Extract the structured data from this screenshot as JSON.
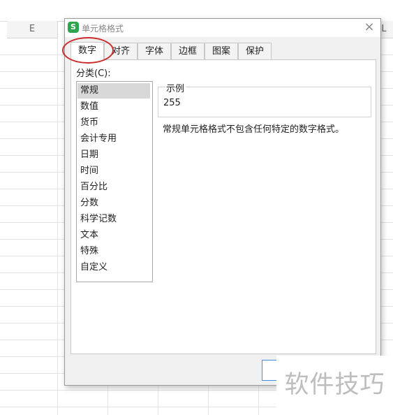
{
  "spreadsheet": {
    "columns": [
      "E",
      "L"
    ]
  },
  "dialog": {
    "title": "单元格格式",
    "app_icon_letter": "S",
    "close_symbol": "×",
    "tabs": [
      "数字",
      "对齐",
      "字体",
      "边框",
      "图案",
      "保护"
    ],
    "active_tab": "数字",
    "category_label": "分类(C):",
    "categories": [
      "常规",
      "数值",
      "货币",
      "会计专用",
      "日期",
      "时间",
      "百分比",
      "分数",
      "科学记数",
      "文本",
      "特殊",
      "自定义"
    ],
    "selected_category": "常规",
    "sample_label": "示例",
    "sample_value": "255",
    "description": "常规单元格格式不包含任何特定的数字格式。"
  },
  "watermark": "软件技巧",
  "colors": {
    "annotation": "#cc2b2b",
    "app_icon": "#2ea44f",
    "ok_border": "#3d8de0"
  }
}
